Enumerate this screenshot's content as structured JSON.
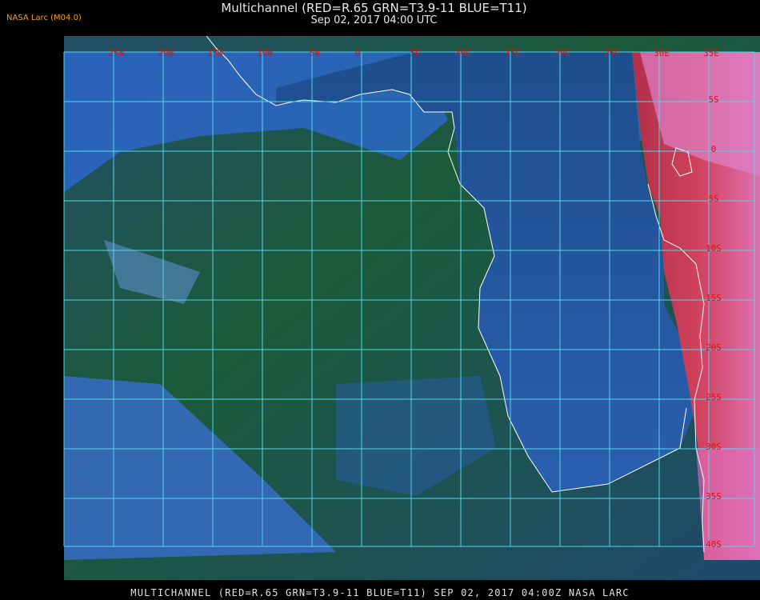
{
  "header": {
    "brand": "NASA Larc (M04.0)",
    "title": "Multichannel (RED=R.65 GRN=T3.9-11 BLUE=T11)",
    "subtitle": "Sep 02, 2017 04:00 UTC"
  },
  "map": {
    "longitude_labels": [
      "25W",
      "20W",
      "15W",
      "10W",
      "5W",
      "0",
      "5E",
      "10E",
      "15E",
      "20E",
      "25E",
      "30E",
      "35E"
    ],
    "latitude_labels": [
      "5S",
      "0",
      "5S",
      "10S",
      "15S",
      "20S",
      "25S",
      "30S",
      "35S",
      "40S"
    ],
    "colors": {
      "grid": "#4fd8e8",
      "coastline": "#ffffff",
      "label": "#dd1111",
      "ocean": "#1f5a3a",
      "cloud": "#3a6fe0",
      "land": "#c83a4a"
    }
  },
  "footer": {
    "caption": "MULTICHANNEL (RED=R.65 GRN=T3.9-11 BLUE=T11) SEP 02, 2017 04:00Z   NASA LARC"
  }
}
